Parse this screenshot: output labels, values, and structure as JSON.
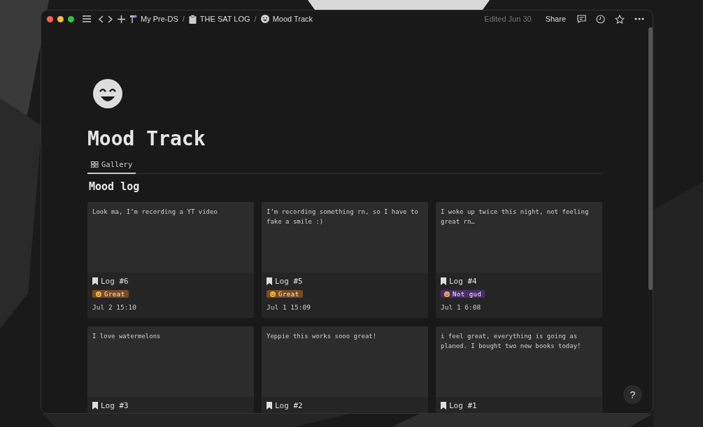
{
  "breadcrumbs": [
    {
      "label": "My Pre-DS",
      "separator": "/"
    },
    {
      "label": "THE SAT LOG",
      "separator": "/"
    },
    {
      "label": "Mood Track"
    }
  ],
  "topbar": {
    "edited": "Edited Jun 30",
    "share": "Share"
  },
  "page": {
    "title": "Mood Track",
    "tabs": [
      {
        "label": "Gallery",
        "selected": true
      }
    ],
    "section": "Mood log"
  },
  "cards": [
    {
      "preview": "Look ma, I’m recording a YT video",
      "title": "Log #6",
      "tag": {
        "label": "Great",
        "color": "#7b4a1f"
      },
      "date": "Jul 2 15:10"
    },
    {
      "preview": "I’m recording something rn, so I have to fake a smile :)",
      "title": "Log #5",
      "tag": {
        "label": "Great",
        "color": "#7b4a1f"
      },
      "date": "Jul 1 15:09"
    },
    {
      "preview": "I woke up twice this night, not feeling great rn…",
      "title": "Log #4",
      "tag": {
        "label": "Not gud",
        "color": "#4a2c6a"
      },
      "date": "Jul 1 6:08"
    },
    {
      "preview": "I love watermelons",
      "title": "Log #3"
    },
    {
      "preview": "Yeppie this works sooo great!",
      "title": "Log #2"
    },
    {
      "preview": "i feel great, everything is going as planed. I bought two new books today!",
      "title": "Log #1"
    }
  ],
  "help": "?"
}
